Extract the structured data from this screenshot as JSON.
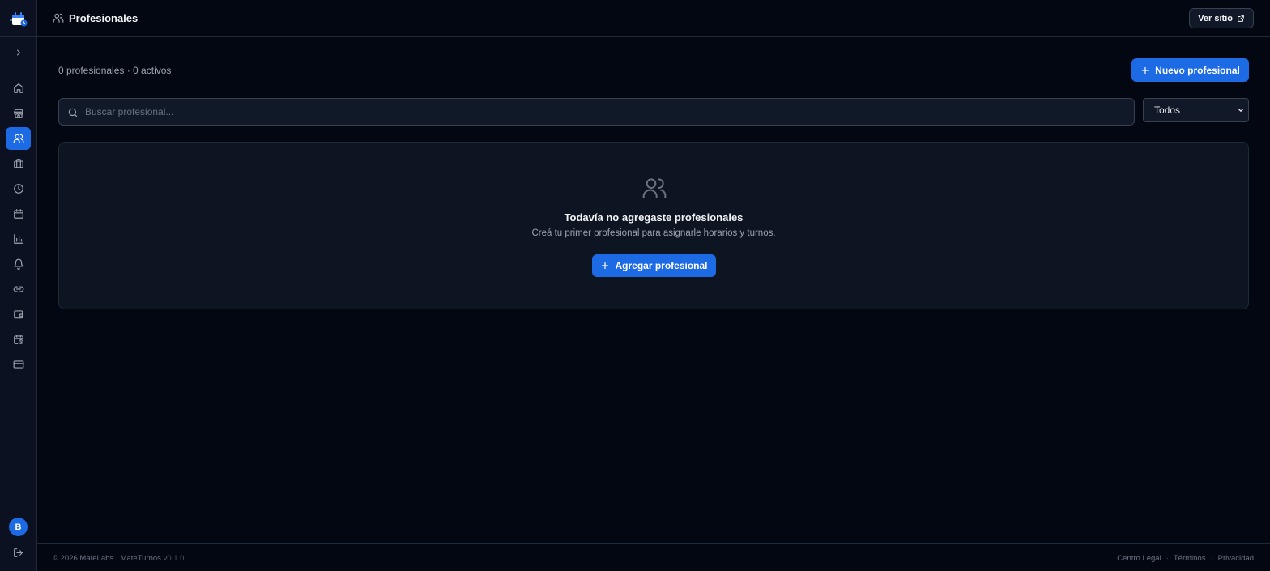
{
  "header": {
    "title": "Profesionales",
    "icon": "users-icon",
    "ver_sitio_label": "Ver sitio"
  },
  "sidebar": {
    "items": [
      {
        "name": "home",
        "icon": "home-icon",
        "active": false
      },
      {
        "name": "store",
        "icon": "store-icon",
        "active": false
      },
      {
        "name": "profesionales",
        "icon": "users-icon",
        "active": true
      },
      {
        "name": "services",
        "icon": "briefcase-icon",
        "active": false
      },
      {
        "name": "schedule",
        "icon": "clock-icon",
        "active": false
      },
      {
        "name": "calendar",
        "icon": "calendar-icon",
        "active": false
      },
      {
        "name": "reports",
        "icon": "bar-chart-icon",
        "active": false
      },
      {
        "name": "notifications",
        "icon": "bell-icon",
        "active": false
      },
      {
        "name": "links",
        "icon": "link-icon",
        "active": false
      },
      {
        "name": "wallet",
        "icon": "wallet-icon",
        "active": false
      },
      {
        "name": "calendar-clock",
        "icon": "calendar-clock-icon",
        "active": false
      },
      {
        "name": "billing",
        "icon": "credit-card-icon",
        "active": false
      }
    ],
    "avatar_initial": "B"
  },
  "main": {
    "counts_text": "0 profesionales · 0 activos",
    "new_button_label": "Nuevo profesional",
    "search_placeholder": "Buscar profesional...",
    "filter_selected": "Todos",
    "empty": {
      "title": "Todavía no agregaste profesionales",
      "subtitle": "Creá tu primer profesional para asignarle horarios y turnos.",
      "button_label": "Agregar profesional"
    }
  },
  "footer": {
    "copyright": "© 2026 MateLabs · MateTurnos",
    "version": "v0.1.0",
    "links": [
      "Centro Legal",
      "Términos",
      "Privacidad"
    ],
    "separator": "·"
  },
  "colors": {
    "accent": "#1d6ae5",
    "background": "#030712",
    "sidebar": "#0b1120",
    "card": "#0d1522"
  }
}
